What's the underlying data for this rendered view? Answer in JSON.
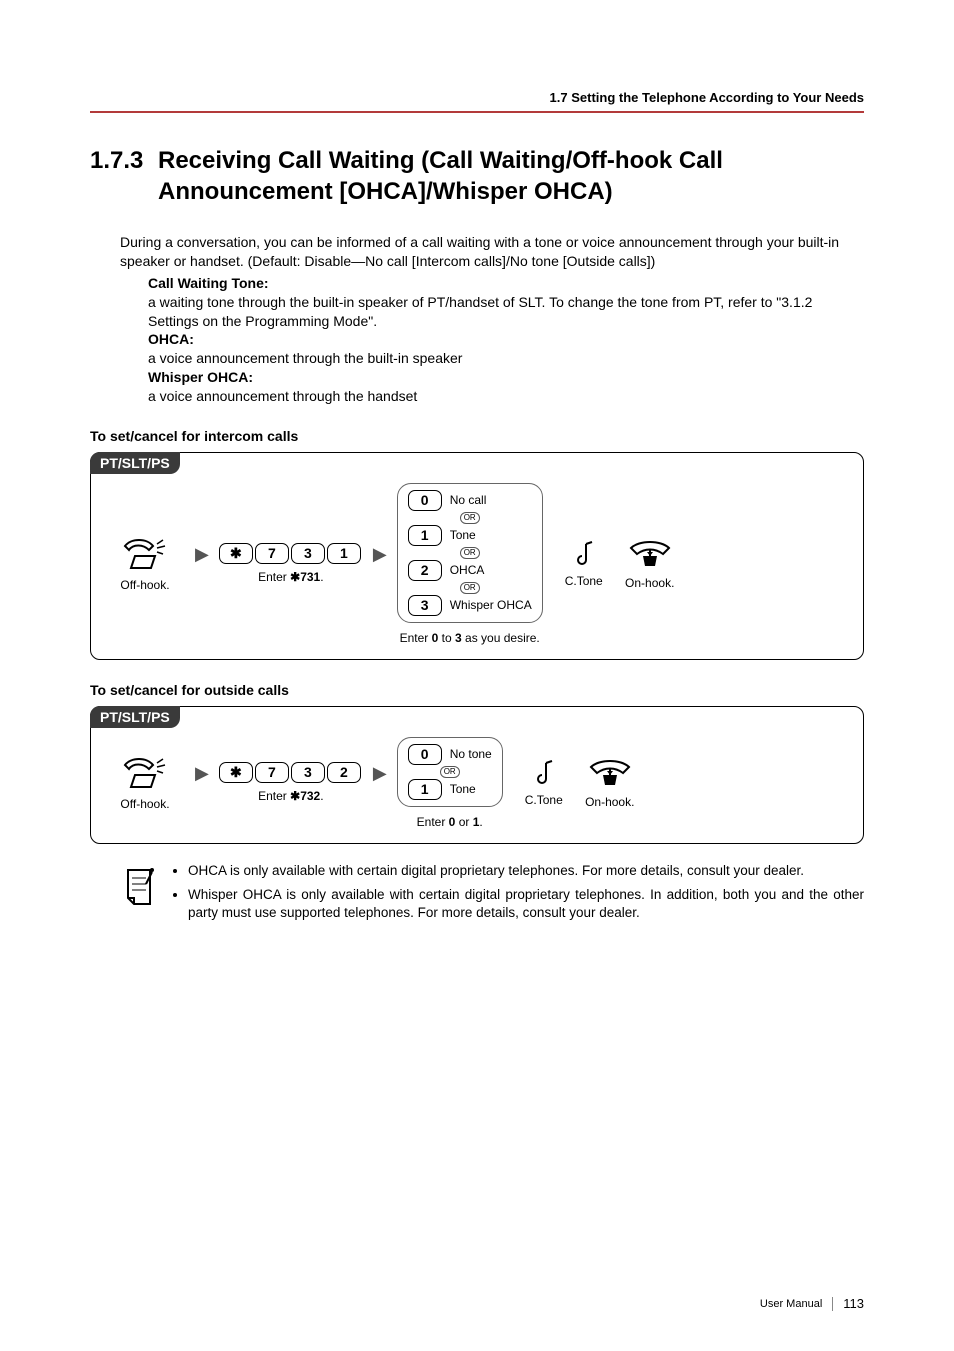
{
  "header": {
    "crumb": "1.7 Setting the Telephone According to Your Needs"
  },
  "section": {
    "number": "1.7.3",
    "title_l1": "Receiving Call Waiting (Call Waiting/Off-hook Call",
    "title_l2": "Announcement [OHCA]/Whisper OHCA)"
  },
  "intro": "During a conversation, you can be informed of a call waiting with a tone or voice announcement through your built-in speaker or handset. (Default: Disable—No call [Intercom calls]/No tone [Outside calls])",
  "defs": {
    "cwt_head": "Call Waiting Tone:",
    "cwt_body": "a waiting tone through the built-in speaker of PT/handset of SLT. To change the tone from PT, refer to \"3.1.2 Settings on the Programming Mode\".",
    "ohca_head": "OHCA:",
    "ohca_body": "a voice announcement through the built-in speaker",
    "wohca_head": "Whisper OHCA:",
    "wohca_body": "a voice announcement through the handset"
  },
  "sub1": "To set/cancel for intercom calls",
  "sub2": "To set/cancel for outside calls",
  "tag": "PT/SLT/PS",
  "steps": {
    "offhook": "Off-hook.",
    "enter731_pre": "Enter ",
    "enter731_code": "731",
    "enter732_code": "732",
    "enter_suffix": ".",
    "ctone": "C.Tone",
    "onhook": "On-hook."
  },
  "keys": {
    "star": "✱",
    "k7": "7",
    "k3": "3",
    "k1": "1",
    "k2": "2",
    "k0": "0"
  },
  "or": "OR",
  "opts1": {
    "r0": "No call",
    "r1": "Tone",
    "r2": "OHCA",
    "r3": "Whisper OHCA",
    "cap_a": "Enter ",
    "cap_b": "0",
    "cap_c": " to ",
    "cap_d": "3",
    "cap_e": " as you desire."
  },
  "opts2": {
    "r0": "No tone",
    "r1": "Tone",
    "cap_a": "Enter ",
    "cap_b": "0",
    "cap_c": " or ",
    "cap_d": "1",
    "cap_e": "."
  },
  "notes": {
    "n1": "OHCA is only available with certain digital proprietary telephones. For more details, consult your dealer.",
    "n2": "Whisper OHCA is only available with certain digital proprietary telephones. In addition, both you and the other party must use supported telephones. For more details, consult your dealer."
  },
  "footer": {
    "label": "User Manual",
    "page": "113"
  }
}
